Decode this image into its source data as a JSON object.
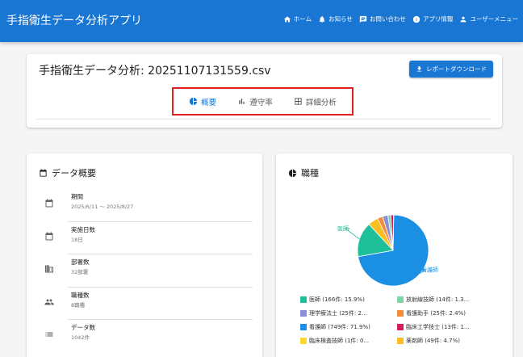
{
  "app": {
    "title": "手指衛生データ分析アプリ"
  },
  "nav": [
    {
      "label": "ホーム",
      "icon": "home-icon"
    },
    {
      "label": "お知らせ",
      "icon": "bell-icon"
    },
    {
      "label": "お問い合わせ",
      "icon": "message-icon"
    },
    {
      "label": "アプリ情報",
      "icon": "info-icon"
    },
    {
      "label": "ユーザーメニュー",
      "icon": "user-icon"
    }
  ],
  "header": {
    "file_title": "手指衛生データ分析: 20251107131559.csv",
    "download_label": "レポートダウンロード",
    "tabs": [
      {
        "label": "概要",
        "icon": "pie-chart-icon",
        "active": true
      },
      {
        "label": "遵守率",
        "icon": "bar-chart-icon",
        "active": false
      },
      {
        "label": "詳細分析",
        "icon": "table-icon",
        "active": false
      }
    ]
  },
  "overview": {
    "title": "データ概要",
    "items": [
      {
        "label": "期間",
        "value": "2025/6/11 〜 2025/8/27",
        "icon": "calendar-icon"
      },
      {
        "label": "実施日数",
        "value": "18日",
        "icon": "calendar-icon"
      },
      {
        "label": "部署数",
        "value": "32部署",
        "icon": "building-icon"
      },
      {
        "label": "職種数",
        "value": "8職種",
        "icon": "people-icon"
      },
      {
        "label": "データ数",
        "value": "1042件",
        "icon": "list-icon"
      }
    ]
  },
  "jobs": {
    "title": "職種",
    "pie_labels": {
      "doctor": "医師",
      "nurse": "看護師"
    }
  },
  "chart_data": {
    "type": "pie",
    "title": "職種",
    "series": [
      {
        "name": "看護師",
        "value": 749,
        "percent": 71.9,
        "color": "#1a8fe3"
      },
      {
        "name": "医師",
        "value": 166,
        "percent": 15.9,
        "color": "#1fbf9a"
      },
      {
        "name": "薬剤師",
        "value": 49,
        "percent": 4.7,
        "color": "#fbbf24"
      },
      {
        "name": "看護助手",
        "value": 25,
        "percent": 2.4,
        "color": "#f58b3d"
      },
      {
        "name": "理学療法士",
        "value": 25,
        "percent": 2.4,
        "color": "#8b8fd8"
      },
      {
        "name": "放射線技師",
        "value": 14,
        "percent": 1.3,
        "color": "#7fd6a3"
      },
      {
        "name": "臨床工学技士",
        "value": 13,
        "percent": 1.2,
        "color": "#d81b60"
      },
      {
        "name": "臨床検査技師",
        "value": 1,
        "percent": 0.1,
        "color": "#fdd835"
      }
    ],
    "legend": [
      {
        "text": "医師 (166件: 15.9%)",
        "color": "#1fbf9a"
      },
      {
        "text": "放射線技師 (14件: 1.3...",
        "color": "#7fd6a3"
      },
      {
        "text": "理学療法士 (25件: 2...",
        "color": "#8b8fd8"
      },
      {
        "text": "看護助手 (25件: 2.4%)",
        "color": "#f58b3d"
      },
      {
        "text": "看護師 (749件: 71.9%)",
        "color": "#1a8fe3"
      },
      {
        "text": "臨床工学技士 (13件: 1...",
        "color": "#d81b60"
      },
      {
        "text": "臨床検査技師 (1件: 0...",
        "color": "#fdd835"
      },
      {
        "text": "薬剤師 (49件: 4.7%)",
        "color": "#fbbf24"
      }
    ]
  }
}
